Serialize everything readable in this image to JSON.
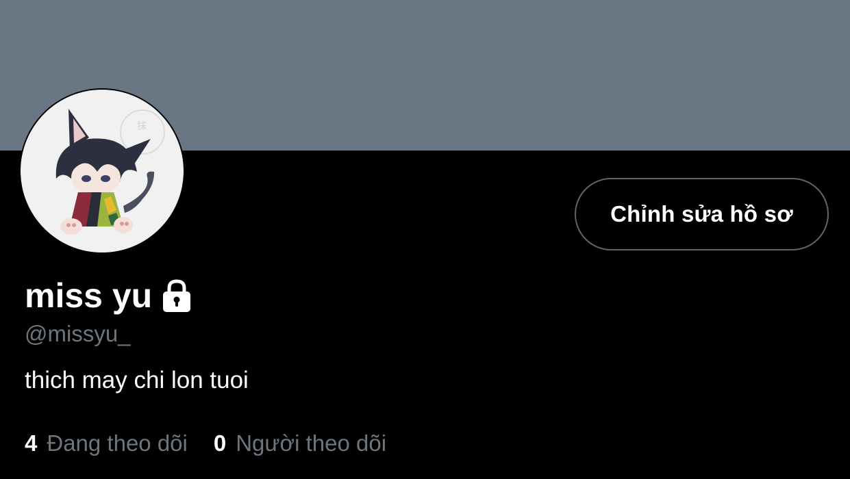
{
  "profile": {
    "banner_color": "#697684",
    "avatar_icon": "avatar-image",
    "display_name": "miss yu",
    "protected_icon": "lock-icon",
    "handle": "@missyu_",
    "bio": "thich may chi lon tuoi",
    "edit_button_label": "Chỉnh sửa hồ sơ",
    "following_count": "4",
    "following_label": "Đang theo dõi",
    "followers_count": "0",
    "followers_label": "Người theo dõi"
  },
  "colors": {
    "background": "#000000",
    "primary_text": "#ffffff",
    "secondary_text": "#6e767d",
    "button_border": "#5d6670"
  }
}
